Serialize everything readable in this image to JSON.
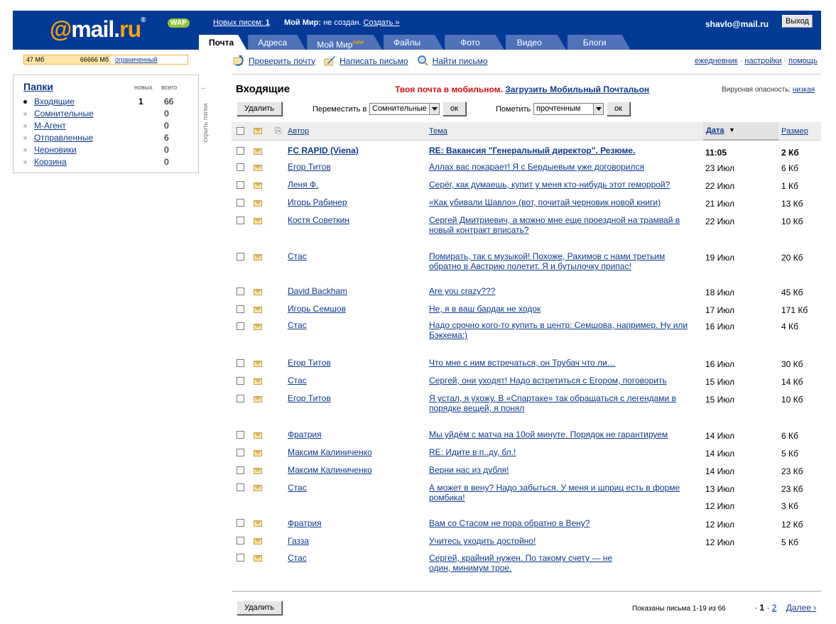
{
  "header": {
    "logo": {
      "at": "@",
      "mail": "mail",
      "dot": ".",
      "ru": "ru",
      "reg": "®"
    },
    "wap": "WAP",
    "new_letters_label": "Новых писем:",
    "new_letters_count": "1",
    "my_world_label": "Мой Мир:",
    "my_world_status": "не создан.",
    "create_link": "Создать »",
    "user_email": "shavlo@mail.ru",
    "logout": "Выход",
    "tabs": [
      {
        "label": "Почта"
      },
      {
        "label": "Адреса"
      },
      {
        "label": "Мой Мир",
        "badge": "new"
      },
      {
        "label": "Файлы"
      },
      {
        "label": "Фото"
      },
      {
        "label": "Видео"
      },
      {
        "label": "Блоги"
      }
    ]
  },
  "quota": {
    "used": "47 Мб",
    "total": "66666 Мб",
    "limit_link": "ограниченный"
  },
  "folders": {
    "title": "Папки",
    "col_new": "новых",
    "col_total": "всего",
    "hide": "скрыть папки",
    "items": [
      {
        "name": "Входящие",
        "new": "1",
        "total": "66"
      },
      {
        "name": "Сомнительные",
        "new": "",
        "total": "0"
      },
      {
        "name": "М-Агент",
        "new": "",
        "total": "0"
      },
      {
        "name": "Отправленные",
        "new": "",
        "total": "6"
      },
      {
        "name": "Черновики",
        "new": "",
        "total": "0"
      },
      {
        "name": "Корзина",
        "new": "",
        "total": "0"
      }
    ]
  },
  "actions": {
    "check": "Проверить почту",
    "compose": "Написать письмо",
    "find": "Найти письмо",
    "diary": "ежедневник",
    "settings": "настройки",
    "help": "помощь",
    "sep": "·"
  },
  "inbox": {
    "title": "Входящие",
    "promo_red": "Твоя почта в мобильном.",
    "promo_link": "Загрузить Мобильный Почтальон",
    "virus_label": "Вирусная опасность:",
    "virus_level": "низкая",
    "delete": "Удалить",
    "move_label": "Переместить в",
    "move_value": "Сомнительные",
    "ok": "ок",
    "mark_label": "Пометить",
    "mark_value": "прочтенным"
  },
  "table": {
    "col_author": "Автор",
    "col_subject": "Тема",
    "col_date": "Дата",
    "col_size": "Размер",
    "rows": [
      {
        "author": "FC RAPID (Viena)",
        "subject": "RE: Вакансия \"Генеральный директор\". Резюме.",
        "date": "11:05",
        "size": "2 Кб",
        "unread": true
      },
      {
        "author": "Егор Титов",
        "subject": "Аллах вас покарает! Я с Бердыевым уже договорился",
        "date": "23 Июл",
        "size": "6 Кб"
      },
      {
        "author": "Леня Ф.",
        "subject": "Серёг, как думаешь, купит у меня кто-нибудь этот геморрой?",
        "date": "22 Июл",
        "size": "1 Кб"
      },
      {
        "author": "Игорь Рабинер",
        "subject": "«Как убивали Шавло» (вот, почитай черновик новой книги)",
        "date": "21 Июл",
        "size": "13 Кб"
      },
      {
        "author": "Костя Советкин",
        "subject": "Сергей Дмитриевич, а можно мне еще проездной на трамвай в новый контракт вписать?",
        "date": "22 Июл",
        "size": "10 Кб"
      },
      {
        "author": "Стас",
        "subject": "Помирать, так с музыкой! Похоже, Рахимов с нами третьим обратно в Австрию полетит. Я и бутылочку припас!",
        "date": "19 Июл",
        "size": "20 Кб"
      },
      {
        "author": "David Backham",
        "subject": "Are you crazy???",
        "date": "18 Июл",
        "size": "45 Кб"
      },
      {
        "author": "Игорь Семшов",
        "subject": "Не, я в ваш бардак не ходок",
        "date": "17 Июл",
        "size": "171 Кб"
      },
      {
        "author": "Стас",
        "subject": "Надо срочно кого-то купить в центр: Семшова, например. Ну или Бэкхема:)",
        "date": "16 Июл",
        "size": "4 Кб"
      },
      {
        "author": "Егор Титов",
        "subject": "Что мне с ним встречаться, он Трубач что ли…",
        "date": "16 Июл",
        "size": "30 Кб"
      },
      {
        "author": "Стас",
        "subject": "Сергей, они уходят! Надо встретиться с Егором, поговорить",
        "date": "15 Июл",
        "size": "14 Кб"
      },
      {
        "author": "Егор Титов",
        "subject": "Я устал, я ухожу. В «Спартаке» так обращаться с легендами в порядке вещей, я понял",
        "date": "15 Июл",
        "size": "10 Кб"
      },
      {
        "author": "Фратрия",
        "subject": "Мы уйдём с матча на 10ой минуте. Порядок не гарантируем",
        "date": "14 Июл",
        "size": "6 Кб"
      },
      {
        "author": "Максим Калиниченко",
        "subject": "RE: Идите в п..ду, бл.!",
        "date": "14 Июл",
        "size": "5 Кб"
      },
      {
        "author": "Максим Калиниченко",
        "subject": "Верни нас  из дубля!",
        "date": "14 Июл",
        "size": "23 Кб"
      },
      {
        "author": "Стас",
        "subject": "А может в вену? Надо забыться. У меня и шприц есть  в форме ромбика!",
        "date": "13 Июл",
        "size": "23 Кб"
      },
      {
        "author": "",
        "subject": "",
        "date": "12 Июл",
        "size": "3 Кб",
        "blank": true
      },
      {
        "author": "Фратрия",
        "subject": "Вам со Стасом не пора обратно в Вену?",
        "date": "12 Июл",
        "size": "12 Кб"
      },
      {
        "author": "Газза",
        "subject": "Учитесь уходить достойно!",
        "date": "12 Июл",
        "size": "5 Кб"
      },
      {
        "author": "Стас",
        "subject": "Сергей, крайний нужен. По такому счету — не один, минимум трое.",
        "date": "",
        "size": ""
      }
    ]
  },
  "footer": {
    "delete": "Удалить",
    "shown": "Показаны письма 1-19 из 66",
    "pager_dot": "·",
    "page_current": "1",
    "page_next": "2",
    "next_link": "Далее ›"
  }
}
